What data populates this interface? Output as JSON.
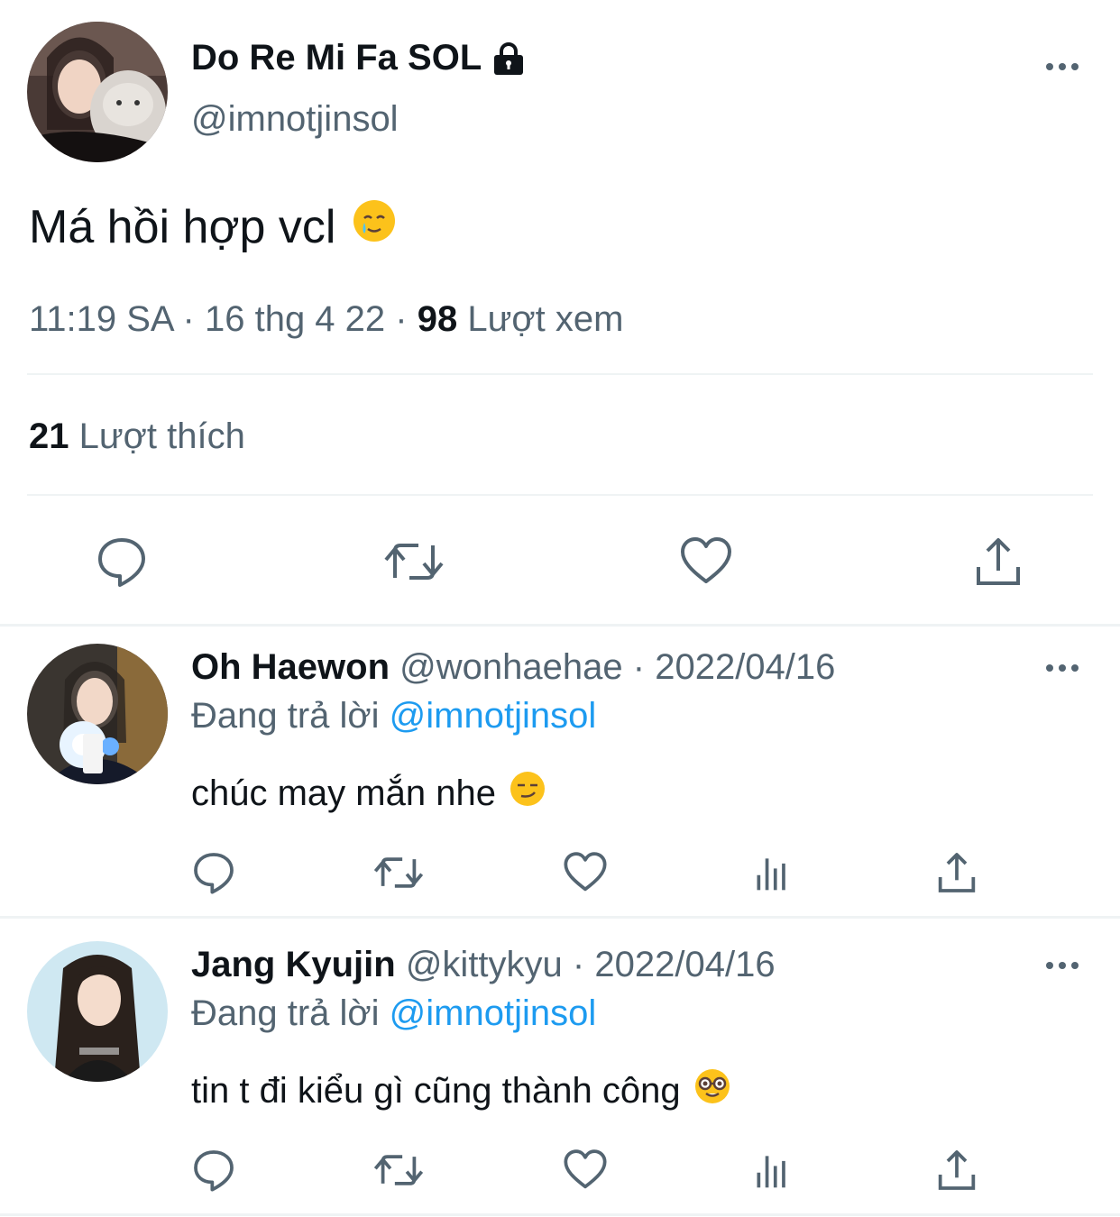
{
  "tweet": {
    "author_name": "Do Re Mi Fa SOL",
    "author_handle": "@imnotjinsol",
    "text": "Má hồi hợp vcl",
    "emoji_icon": "crying-smile-emoji",
    "time": "11:19 SA",
    "date": "16 thg 4 22",
    "views_count": "98",
    "views_label": "Lượt xem",
    "likes_count": "21",
    "likes_label": "Lượt thích"
  },
  "replies": [
    {
      "name": "Oh Haewon",
      "handle": "@wonhaehae",
      "date": "2022/04/16",
      "replying_label": "Đang trả lời",
      "replying_to": "@imnotjinsol",
      "text": "chúc may mắn nhe",
      "emoji_icon": "smirk-emoji"
    },
    {
      "name": "Jang Kyujin",
      "handle": "@kittykyu",
      "date": "2022/04/16",
      "replying_label": "Đang trả lời",
      "replying_to": "@imnotjinsol",
      "text": "tin t đi kiểu gì cũng thành công",
      "emoji_icon": "nerd-emoji"
    }
  ],
  "separator": "·",
  "colors": {
    "text_primary": "#0f1419",
    "text_secondary": "#536471",
    "mention": "#1d9bf0",
    "divider": "#eff3f4"
  }
}
